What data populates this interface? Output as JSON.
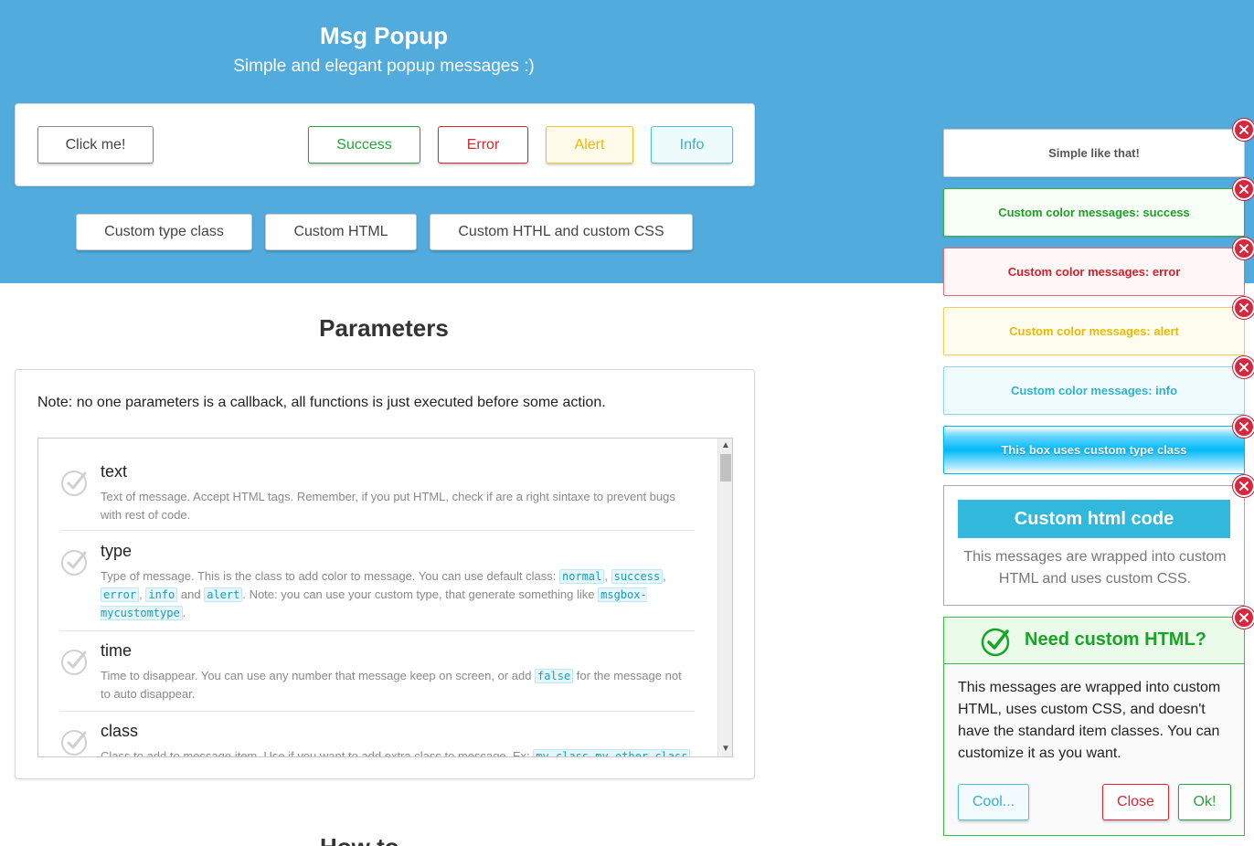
{
  "header": {
    "title": "Msg Popup",
    "subtitle": "Simple and elegant popup messages :)"
  },
  "demo_buttons": {
    "click_me": "Click me!",
    "success": "Success",
    "error": "Error",
    "alert": "Alert",
    "info": "Info"
  },
  "custom_buttons": {
    "custom_type": "Custom type class",
    "custom_html": "Custom HTML",
    "custom_html_css": "Custom HTHL and custom CSS"
  },
  "parameters": {
    "title": "Parameters",
    "note": "Note: no one parameters is a callback, all functions is just executed before some action.",
    "items": [
      {
        "name": "text",
        "desc": "Text of message. Accept HTML tags. Remember, if you put HTML, check if are a right sintaxe to prevent bugs with rest of code."
      },
      {
        "name": "type",
        "desc_a": "Type of message. This is the class to add color to message. You can use default class: ",
        "code_normal": "normal",
        "code_success": "success",
        "code_error": "error",
        "code_info": "info",
        "and": "and",
        "code_alert": "alert",
        "desc_b": ". Note: you can use your custom type, that generate something like ",
        "code_custom": "msgbox-mycustomtype",
        "desc_c": "."
      },
      {
        "name": "time",
        "desc_a": "Time to disappear. You can use any number that message keep on screen, or add ",
        "code_false": "false",
        "desc_b": " for the message not to auto disappear."
      },
      {
        "name": "class",
        "desc_a": "Class to add to message item. Use if you want to add extra class to message. Ex: ",
        "code_class": "my-class my-other-class"
      }
    ]
  },
  "howto_title": "How to",
  "toasts": {
    "simple": "Simple like that!",
    "success": "Custom color messages: success",
    "error": "Custom color messages: error",
    "alert": "Custom color messages: alert",
    "info": "Custom color messages: info",
    "custom_type": "This box uses custom type class"
  },
  "html_box": {
    "heading": "Custom html code",
    "text": "This messages are wrapped into custom HTML and uses custom CSS."
  },
  "big_box": {
    "title": "Need custom HTML?",
    "text": "This messages are wrapped into custom HTML, uses custom CSS, and doesn't have the standard item classes. You can customize it as you want.",
    "btn_cool": "Cool...",
    "btn_close": "Close",
    "btn_ok": "Ok!"
  },
  "colors": {
    "hero": "#51abdc",
    "success": "#27a33a",
    "error": "#d9262f",
    "alert": "#e9b800",
    "info": "#35b1ca"
  },
  "icons": {
    "check": "check-circle-icon",
    "close": "close-circle-icon",
    "scroll_up": "chevron-up-icon",
    "scroll_down": "chevron-down-icon"
  }
}
